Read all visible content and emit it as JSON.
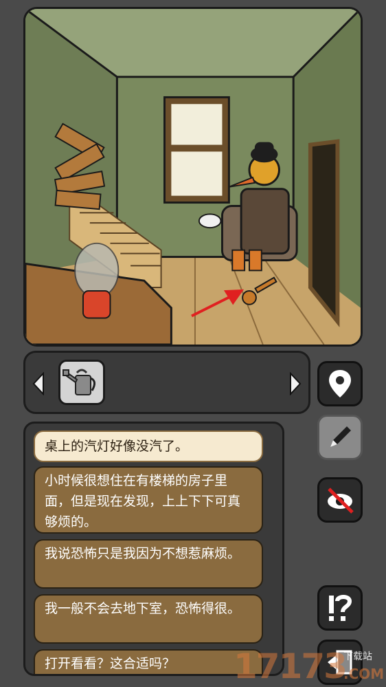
{
  "scene": {
    "name": "living room with staircase"
  },
  "inventory": {
    "prev_icon": "chevron-left-icon",
    "next_icon": "chevron-right-icon",
    "items": [
      {
        "icon": "watering-can-icon"
      }
    ]
  },
  "tools": {
    "map": "map-pin-icon",
    "notes": "pencil-icon",
    "hide": "eye-crossed-icon",
    "hint": "exclamation-question-icon",
    "exit": "exit-door-icon"
  },
  "dialogue": {
    "options": [
      {
        "text": "桌上的汽灯好像没汽了。",
        "selected": true
      },
      {
        "text": "小时候很想住在有楼梯的房子里面，但是现在发现，上上下下可真够烦的。",
        "selected": false
      },
      {
        "text": "我说恐怖只是我因为不想惹麻烦。",
        "selected": false
      },
      {
        "text": "我一般不会去地下室，恐怖得很。",
        "selected": false
      },
      {
        "text": "打开看看？这合适吗？",
        "selected": false
      }
    ]
  },
  "watermark": {
    "number": "17173",
    "tag": "下载站",
    "domain": ".COM"
  },
  "colors": {
    "option_bg": "#8a6b3f",
    "option_selected_bg": "#f6ead0",
    "arrow": "#e02020"
  }
}
